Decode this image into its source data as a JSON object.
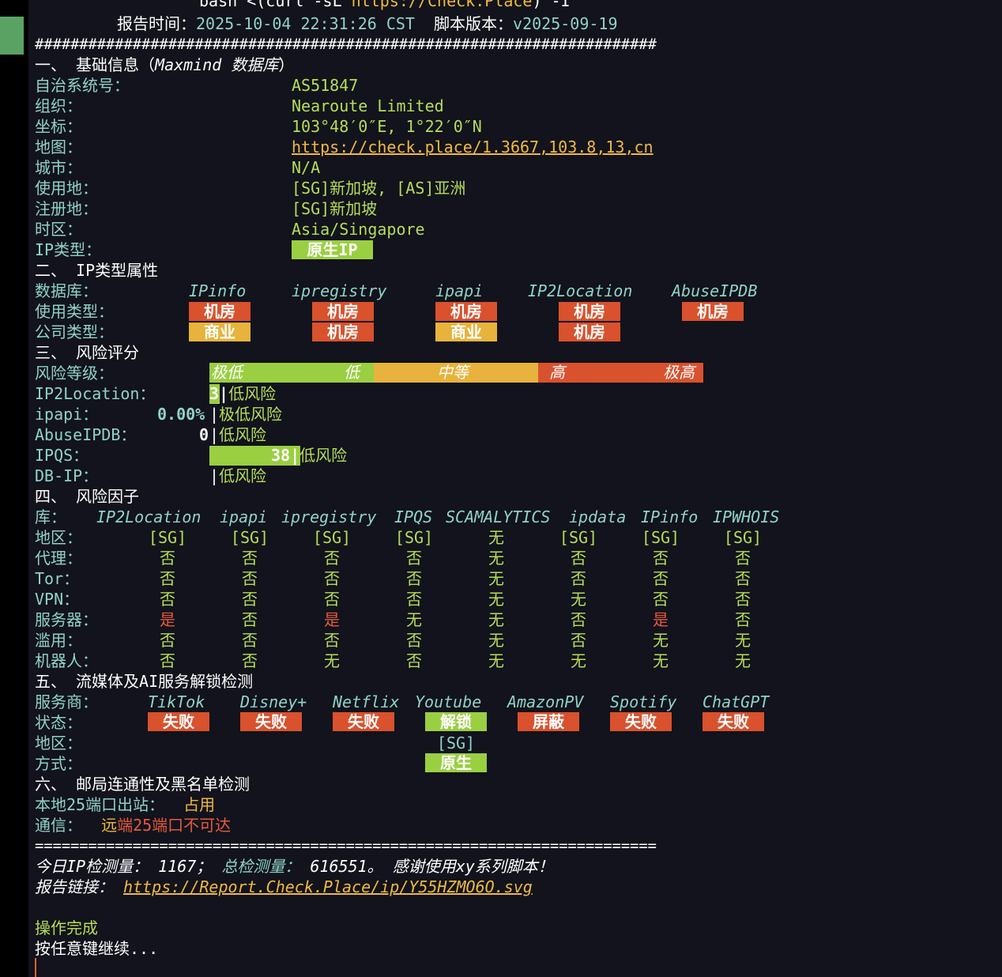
{
  "top": {
    "cmd_prefix": "bash <(curl -sL ",
    "cmd_url": "https://Check.Place",
    "cmd_suffix": ") -I",
    "report_time_label": "报告时间：",
    "report_time_value": "2025-10-04 22:31:26 CST",
    "script_ver_label": "脚本版本：",
    "script_ver_value": "v2025-09-19",
    "hashes": "######################################################################"
  },
  "s1": {
    "title_a": "一、 基础信息（",
    "title_b": "Maxmind 数据库",
    "title_c": "）",
    "rows": [
      {
        "label": "自治系统号：",
        "value": "AS51847"
      },
      {
        "label": "组织：",
        "value": "Nearoute Limited"
      },
      {
        "label": "坐标：",
        "value": "103°48′0″E, 1°22′0″N"
      },
      {
        "label": "地图：",
        "value": "https://check.place/1.3667,103.8,13,cn"
      },
      {
        "label": "城市：",
        "value": "N/A"
      },
      {
        "label": "使用地：",
        "value": "[SG]新加坡, [AS]亚洲"
      },
      {
        "label": "注册地：",
        "value": "[SG]新加坡"
      },
      {
        "label": "时区：",
        "value": "Asia/Singapore"
      }
    ],
    "ip_type_label": "IP类型：",
    "ip_type_value": "原生IP"
  },
  "s2": {
    "title": "二、 IP类型属性",
    "db_label": "数据库：",
    "usage_label": "使用类型：",
    "company_label": "公司类型：",
    "dbs": [
      "IPinfo",
      "ipregistry",
      "ipapi",
      "IP2Location",
      "AbuseIPDB"
    ],
    "usage": [
      {
        "text": "机房",
        "color": "#d9512d"
      },
      {
        "text": "机房",
        "color": "#d9512d"
      },
      {
        "text": "机房",
        "color": "#d9512d"
      },
      {
        "text": "机房",
        "color": "#d9512d"
      },
      {
        "text": "机房",
        "color": "#d9512d"
      }
    ],
    "company": [
      {
        "text": "商业",
        "color": "#e7b33c"
      },
      {
        "text": "机房",
        "color": "#d9512d"
      },
      {
        "text": "商业",
        "color": "#e7b33c"
      },
      {
        "text": "机房",
        "color": "#d9512d"
      },
      {
        "text": "",
        "color": ""
      }
    ]
  },
  "s3": {
    "title": "三、 风险评分",
    "level_label": "风险等级：",
    "scale": {
      "very_low": "极低",
      "low": "低",
      "mid": "中等",
      "high": "高",
      "very_high": "极高"
    },
    "rows": [
      {
        "label": "IP2Location：",
        "score": "3",
        "level": "低风险"
      },
      {
        "label": "ipapi：",
        "score": "0.00%",
        "level": "极低风险"
      },
      {
        "label": "AbuseIPDB：",
        "score": "0",
        "level": "低风险"
      },
      {
        "label": "IPQS：",
        "score": "38",
        "level": "低风险"
      },
      {
        "label": "DB-IP：",
        "score": "",
        "level": "低风险"
      }
    ]
  },
  "s4": {
    "title": "四、 风险因子",
    "lib_label": "库：",
    "libs": [
      "IP2Location",
      "ipapi",
      "ipregistry",
      "IPQS",
      "SCAMALYTICS",
      "ipdata",
      "IPinfo",
      "IPWHOIS"
    ],
    "row_labels": [
      "地区：",
      "代理：",
      "Tor：",
      "VPN：",
      "服务器：",
      "滥用：",
      "机器人："
    ],
    "region": [
      "[SG]",
      "[SG]",
      "[SG]",
      "[SG]",
      "无",
      "[SG]",
      "[SG]",
      "[SG]"
    ],
    "proxy": [
      "否",
      "否",
      "否",
      "否",
      "无",
      "否",
      "否",
      "否"
    ],
    "tor": [
      "否",
      "否",
      "否",
      "否",
      "无",
      "否",
      "否",
      "否"
    ],
    "vpn": [
      "否",
      "否",
      "否",
      "否",
      "无",
      "无",
      "否",
      "否"
    ],
    "server": [
      "是",
      "否",
      "是",
      "无",
      "无",
      "否",
      "是",
      "否"
    ],
    "abuse": [
      "否",
      "否",
      "否",
      "否",
      "无",
      "否",
      "无",
      "无"
    ],
    "bot": [
      "否",
      "否",
      "无",
      "否",
      "无",
      "无",
      "无",
      "无"
    ]
  },
  "s5": {
    "title": "五、 流媒体及AI服务解锁检测",
    "svc_label": "服务商：",
    "status_label": "状态：",
    "region_label": "地区：",
    "method_label": "方式：",
    "services": [
      "TikTok",
      "Disney+",
      "Netflix",
      "Youtube",
      "AmazonPV",
      "Spotify",
      "ChatGPT"
    ],
    "status": [
      {
        "text": "失败",
        "color": "#d9512d"
      },
      {
        "text": "失败",
        "color": "#d9512d"
      },
      {
        "text": "失败",
        "color": "#d9512d"
      },
      {
        "text": "解锁",
        "color": "#9acf42"
      },
      {
        "text": "屏蔽",
        "color": "#d9512d"
      },
      {
        "text": "失败",
        "color": "#d9512d"
      },
      {
        "text": "失败",
        "color": "#d9512d"
      }
    ],
    "yt_region": "[SG]",
    "yt_method": "原生"
  },
  "s6": {
    "title": "六、 邮局连通性及黑名单检测",
    "port_label": "本地25端口出站：",
    "port_value": "占用",
    "comm_label": "通信：",
    "comm_a": "远",
    "comm_b": "端25端口不可达"
  },
  "footer": {
    "equals": "======================================================================",
    "today_label": "今日IP检测量：",
    "today_value": "1167；",
    "total_label": "总检测量：",
    "total_value": "616551。",
    "thanks": "感谢使用xy系列脚本！",
    "link_label": "报告链接：",
    "link_url": "https://Report.Check.Place/ip/Y55HZMO6O.svg",
    "done": "操作完成",
    "press_key": "按任意键继续..."
  }
}
